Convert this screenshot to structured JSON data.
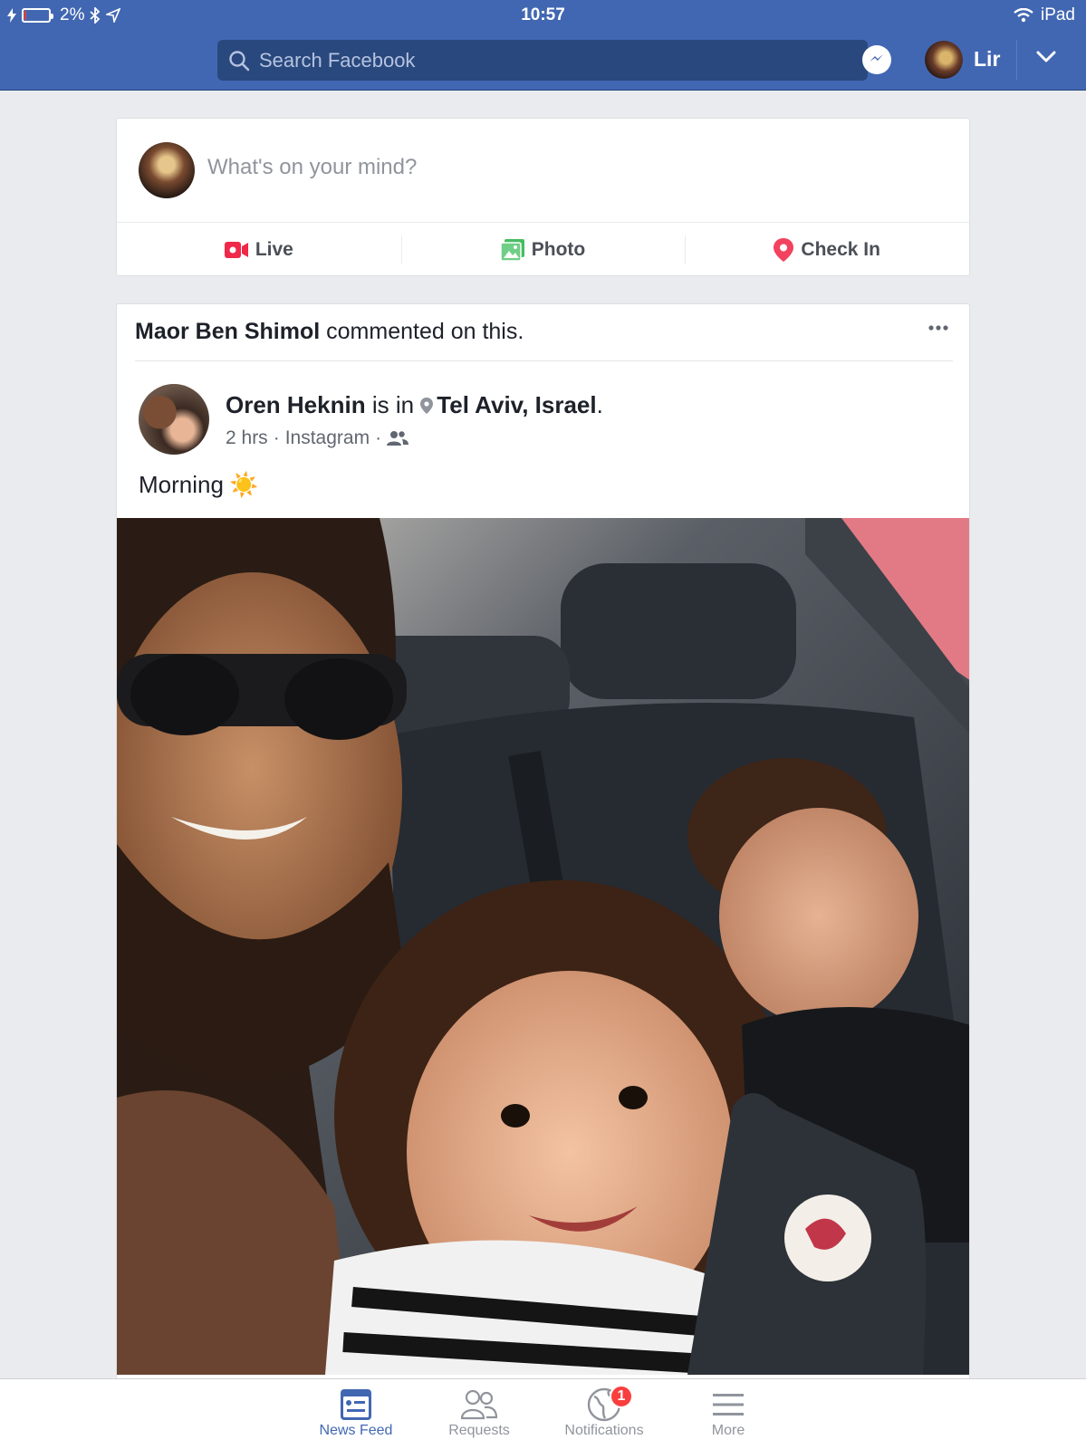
{
  "status_bar": {
    "battery_percent": "2%",
    "time": "10:57",
    "device": "iPad",
    "battery_level": 0.02
  },
  "header": {
    "search_placeholder": "Search Facebook",
    "user_name": "Lir"
  },
  "composer": {
    "placeholder": "What's on your mind?",
    "actions": [
      {
        "label": "Live",
        "icon": "live-video-icon",
        "color": "#f02849"
      },
      {
        "label": "Photo",
        "icon": "photo-icon",
        "color": "#45bd62"
      },
      {
        "label": "Check In",
        "icon": "location-pin-icon",
        "color": "#f3425f"
      }
    ]
  },
  "post": {
    "story_actor": "Maor Ben Shimol",
    "story_action": " commented on this.",
    "author": "Oren Heknin",
    "author_connector": " is in ",
    "location": "Tel Aviv, Israel",
    "location_suffix": ".",
    "time": "2 hrs",
    "separator": "·",
    "source": "Instagram",
    "audience_icon": "friends-icon",
    "text": "Morning",
    "emoji": "☀️"
  },
  "tabs": [
    {
      "label": "News Feed",
      "icon": "news-feed-icon",
      "active": true
    },
    {
      "label": "Requests",
      "icon": "friend-requests-icon",
      "active": false
    },
    {
      "label": "Notifications",
      "icon": "globe-icon",
      "active": false,
      "badge": "1"
    },
    {
      "label": "More",
      "icon": "menu-icon",
      "active": false
    }
  ],
  "colors": {
    "brand_blue": "#4267b2",
    "search_bg": "#29487d",
    "page_bg": "#e9ebee",
    "badge_red": "#fa3e3e"
  }
}
